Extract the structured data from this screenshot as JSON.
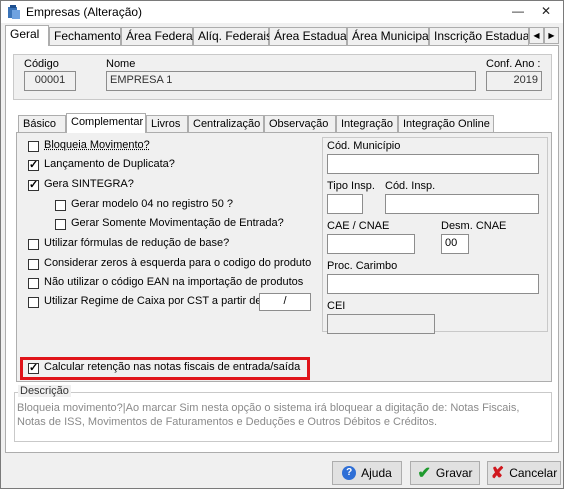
{
  "window": {
    "title": "Empresas (Alteração)",
    "minimize": "—",
    "maximize": "☐",
    "close": "✕"
  },
  "tabs": [
    "Geral",
    "Fechamento",
    "Área Federal",
    "Alíq. Federais",
    "Área Estadual",
    "Área Municipal",
    "Inscrição Estadual S"
  ],
  "header": {
    "codigo_label": "Código",
    "codigo_value": "00001",
    "nome_label": "Nome",
    "nome_value": "EMPRESA 1",
    "conf_ano_label": "Conf. Ano :",
    "conf_ano_value": "2019"
  },
  "subtabs": [
    "Básico",
    "Complementar",
    "Livros",
    "Centralização",
    "Observação",
    "Integração",
    "Integração Online"
  ],
  "checkboxes": [
    {
      "label": "Bloqueia Movimento?",
      "checked": false
    },
    {
      "label": "Lançamento de Duplicata?",
      "checked": true
    },
    {
      "label": "Gera SINTEGRA?",
      "checked": true
    },
    {
      "label": "Gerar modelo 04 no registro 50 ?",
      "checked": false
    },
    {
      "label": "Gerar Somente Movimentação de Entrada?",
      "checked": false
    },
    {
      "label": "Utilizar fórmulas de redução de base?",
      "checked": false
    },
    {
      "label": "Considerar zeros à esquerda para o codigo do produto",
      "checked": false
    },
    {
      "label": "Não utilizar o código EAN na importação de produtos",
      "checked": false
    },
    {
      "label": "Utilizar Regime de Caixa por CST a partir de",
      "checked": false
    },
    {
      "label": "Calcular retenção nas notas fiscais de entrada/saída",
      "checked": true
    }
  ],
  "regime_date": " /",
  "right": {
    "cod_municipio_label": "Cód. Município",
    "cod_municipio_value": "",
    "tipo_insp_label": "Tipo Insp.",
    "tipo_insp_value": "",
    "cod_insp_label": "Cód. Insp.",
    "cod_insp_value": "",
    "cae_cnae_label": "CAE / CNAE",
    "cae_cnae_value": "",
    "desm_cnae_label": "Desm. CNAE",
    "desm_cnae_value": "00",
    "proc_carimbo_label": "Proc. Carimbo",
    "proc_carimbo_value": "",
    "cei_label": "CEI",
    "cei_value": ""
  },
  "description": {
    "title": "Descrição",
    "text": "Bloqueia movimento?|Ao marcar Sim nesta opção o sistema irá bloquear a digitação de: Notas Fiscais, Notas de ISS, Movimentos de Faturamentos e Deduções e Outros Débitos e Créditos."
  },
  "buttons": {
    "ajuda": "Ajuda",
    "gravar": "Gravar",
    "cancelar": "Cancelar"
  },
  "colors": {
    "highlight": "#e0141a",
    "help_icon": "#2f6fd6",
    "save_icon": "#1f9a2e",
    "cancel_icon": "#d0181e"
  }
}
